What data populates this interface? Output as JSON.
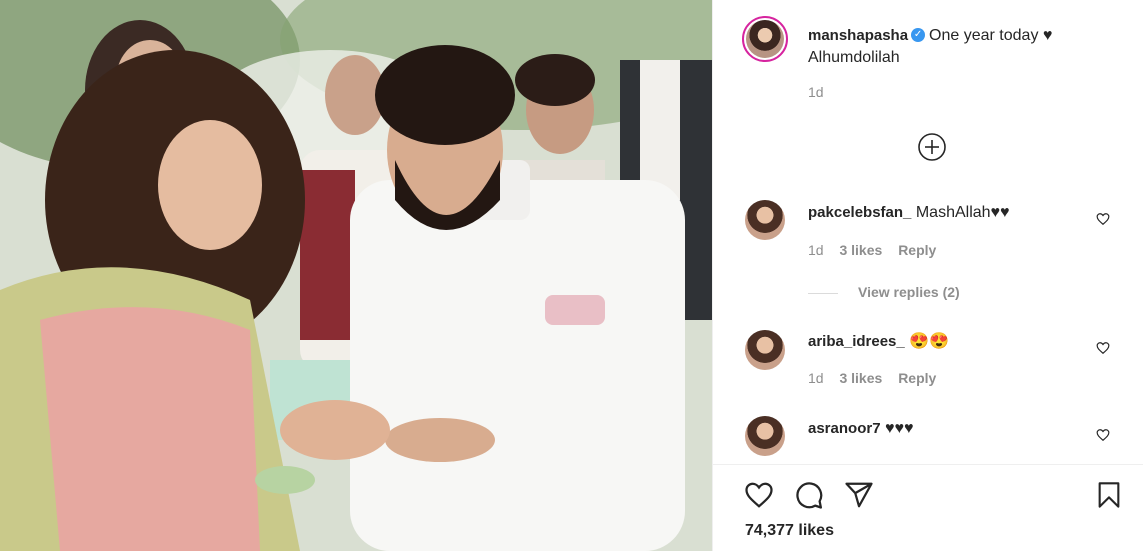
{
  "post": {
    "author": "manshapasha",
    "caption": "One year today ♥",
    "caption_line2": "Alhumdolilah",
    "age": "1d",
    "verified_icon": "verified-badge-icon",
    "load_more_icon": "plus-circle-icon"
  },
  "comments": [
    {
      "user": "pakcelebsfan_",
      "text": "MashAllah♥♥",
      "age": "1d",
      "likes": "3 likes",
      "reply": "Reply",
      "view_replies": "View replies (2)"
    },
    {
      "user": "ariba_idrees_",
      "text": "😍😍",
      "age": "1d",
      "likes": "3 likes",
      "reply": "Reply"
    },
    {
      "user": "asranoor7",
      "text": "♥♥♥"
    }
  ],
  "actions": {
    "icons": [
      "heart-icon",
      "comment-icon",
      "share-icon",
      "bookmark-icon"
    ],
    "likes": "74,377 likes"
  },
  "colors": {
    "verified": "#3897f0",
    "muted": "#8e8e8e",
    "text": "#262626",
    "story_ring": "#d6249f"
  }
}
